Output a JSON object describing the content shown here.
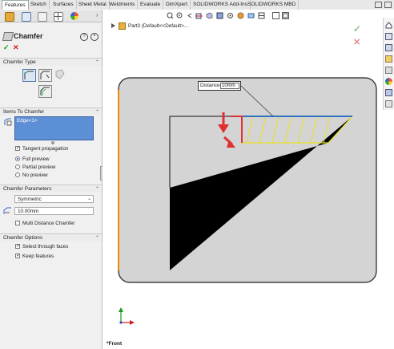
{
  "tabs": [
    "Features",
    "Sketch",
    "Surfaces",
    "Sheet Metal",
    "Weldments",
    "Evaluate",
    "DimXpert",
    "SOLIDWORKS Add-Ins",
    "SOLIDWORKS MBD"
  ],
  "feature": {
    "title": "Chamfer",
    "help_icon": "help-icon",
    "ok_icon": "checkmark-icon",
    "cancel_icon": "x-icon"
  },
  "sections": {
    "chamfer_type": "Chamfer Type",
    "items": "Items To Chamfer",
    "parameters": "Chamfer Parameters",
    "options": "Chamfer Options"
  },
  "items_to_chamfer": {
    "selected": "Edge<1>",
    "tangent_propagation": "Tangent propagation",
    "full_preview": "Full preview",
    "partial_preview": "Partial preview",
    "no_preview": "No preview"
  },
  "parameters": {
    "mode": "Symmetric",
    "distance": "10.00mm",
    "multi_distance": "Multi Distance Chamfer"
  },
  "options": {
    "select_through_faces": "Select through faces",
    "keep_features": "Keep features"
  },
  "viewport": {
    "breadcrumb": "Part3  (Default<<Default>...",
    "distance_label": "Distance:",
    "distance_value": "10mm",
    "view_label": "*Front",
    "accent_blue": "#2f74c0",
    "chamfer_yellow": "#e8e020",
    "arrow_red": "#e03030"
  }
}
